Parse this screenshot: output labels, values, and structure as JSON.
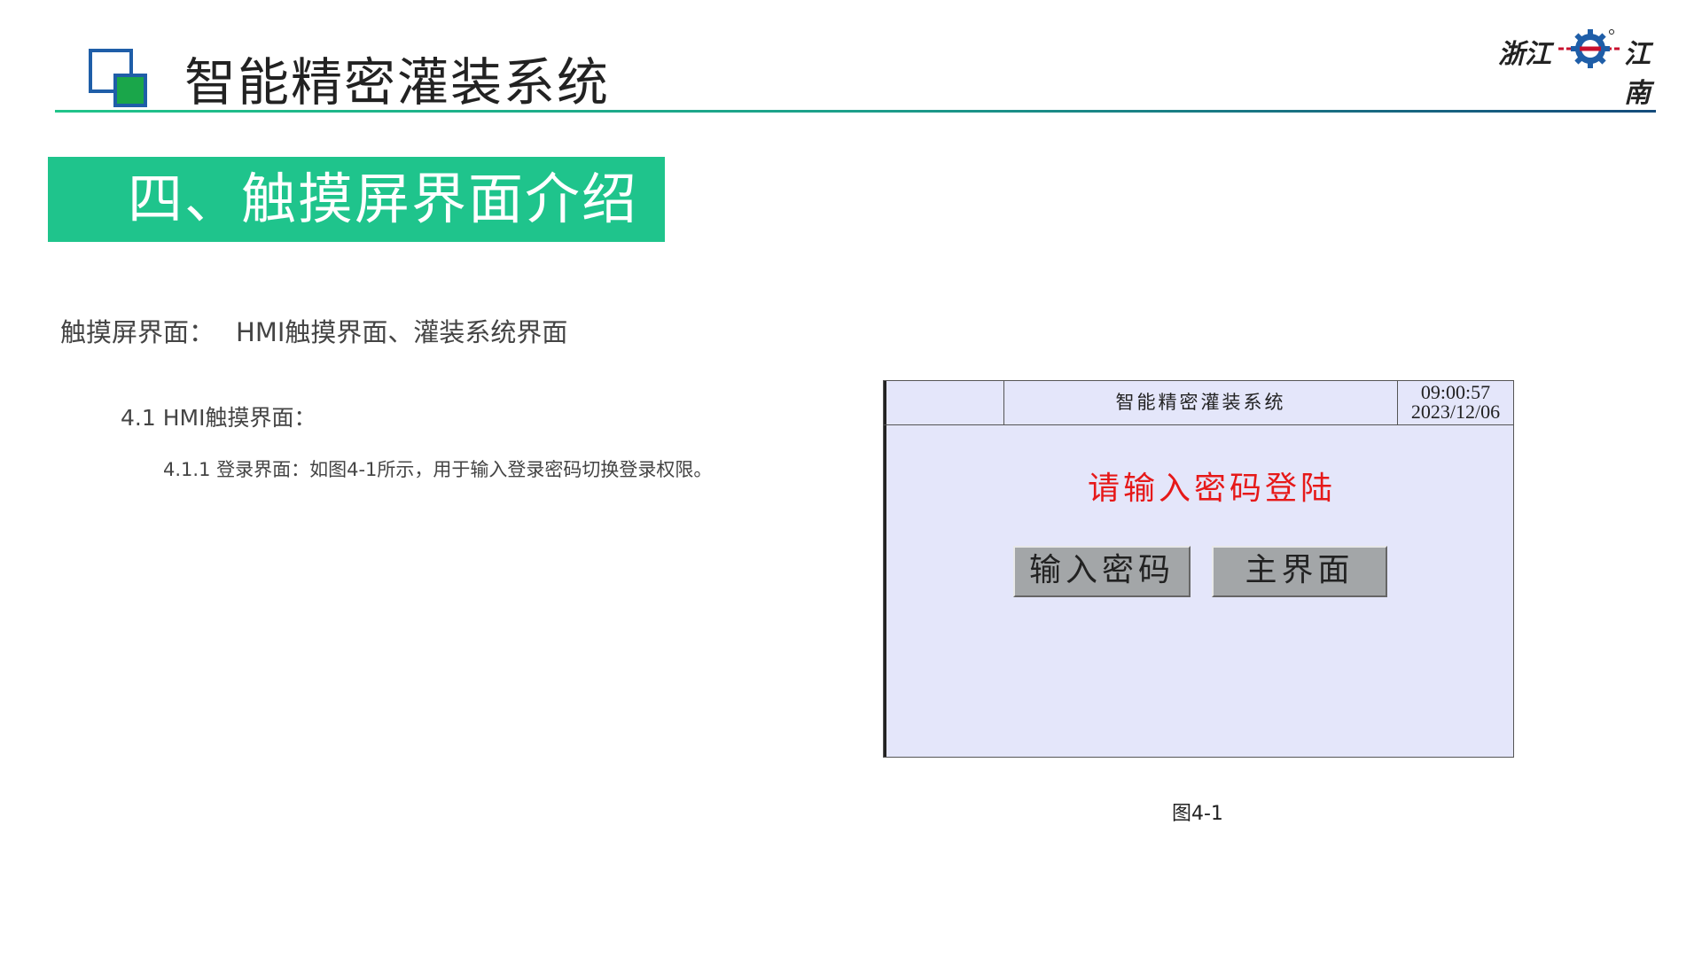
{
  "header": {
    "title": "智能精密灌装系统",
    "brand_left": "浙江",
    "brand_right": "江南"
  },
  "section": {
    "title": "四、触摸屏界面介绍"
  },
  "content": {
    "intro_label": "触摸屏界面：",
    "intro_value": "HMI触摸界面、灌装系统界面",
    "sub1": "4.1  HMI触摸界面：",
    "sub2": "4.1.1  登录界面：如图4-1所示，用于输入登录密码切换登录权限。"
  },
  "hmi": {
    "title": "智能精密灌装系统",
    "time": "09:00:57",
    "date": "2023/12/06",
    "prompt": "请输入密码登陆",
    "btn_password": "输入密码",
    "btn_main": "主界面"
  },
  "figure": {
    "caption": "图4-1"
  },
  "colors": {
    "accent_green": "#1fc48c",
    "prompt_red": "#e61919",
    "hmi_bg": "#e4e6fa",
    "logo_blue": "#1f5ea8"
  }
}
